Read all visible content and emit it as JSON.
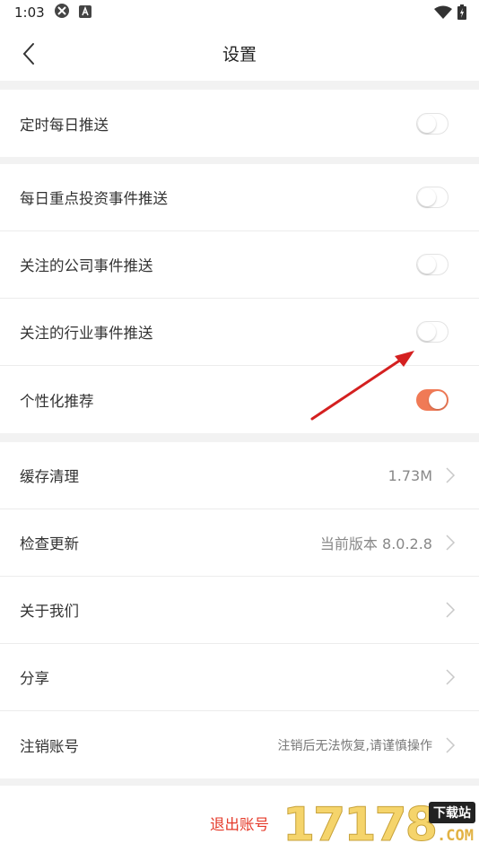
{
  "status_bar": {
    "time": "1:03"
  },
  "header": {
    "title": "设置"
  },
  "groups": [
    {
      "rows": [
        {
          "label": "定时每日推送",
          "toggle": "off"
        }
      ]
    },
    {
      "rows": [
        {
          "label": "每日重点投资事件推送",
          "toggle": "off"
        },
        {
          "label": "关注的公司事件推送",
          "toggle": "off"
        },
        {
          "label": "关注的行业事件推送",
          "toggle": "off"
        },
        {
          "label": "个性化推荐",
          "toggle": "on"
        }
      ]
    },
    {
      "rows": [
        {
          "label": "缓存清理",
          "value": "1.73M"
        },
        {
          "label": "检查更新",
          "value": "当前版本 8.0.2.8"
        },
        {
          "label": "关于我们",
          "value": ""
        },
        {
          "label": "分享",
          "value": ""
        },
        {
          "label": "注销账号",
          "value": "注销后无法恢复,请谨慎操作"
        }
      ]
    }
  ],
  "footer": {
    "logout_label": "退出账号"
  },
  "watermark": {
    "digits": "17178",
    "tag": "下载站",
    "domain": ".COM"
  },
  "colors": {
    "accent": "#f07a56",
    "logout": "#e53a2a",
    "annotation_arrow": "#d42020"
  },
  "icons": [
    "vpn-icon",
    "text-a-icon",
    "wifi-icon",
    "battery-icon",
    "back-arrow-icon",
    "chevron-right-icon",
    "red-annotation-arrow"
  ]
}
